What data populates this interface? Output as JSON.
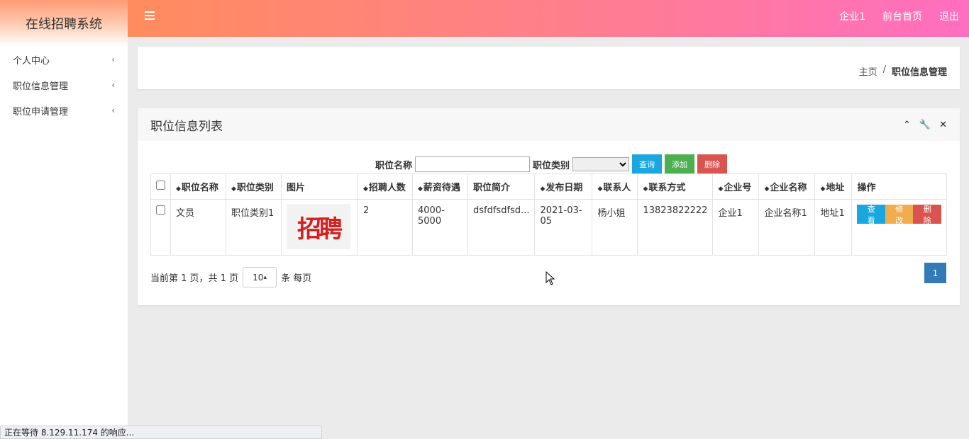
{
  "sidebar": {
    "title": "在线招聘系统",
    "items": [
      {
        "label": "个人中心",
        "chevron": "‹"
      },
      {
        "label": "职位信息管理",
        "chevron": "‹"
      },
      {
        "label": "职位申请管理",
        "chevron": "‹"
      }
    ]
  },
  "topbar": {
    "links": [
      "企业1",
      "前台首页",
      "退出"
    ]
  },
  "breadcrumb": {
    "home": "主页",
    "separator": "/",
    "current": "职位信息管理"
  },
  "panel": {
    "title": "职位信息列表",
    "tools": [
      "⌃",
      "🔧",
      "✕"
    ]
  },
  "search": {
    "name_label": "职位名称",
    "name_value": "",
    "type_label": "职位类别",
    "type_value": "",
    "query_btn": "查询",
    "add_btn": "添加",
    "delete_btn": "删除"
  },
  "table": {
    "headers": [
      "职位名称",
      "职位类别",
      "图片",
      "招聘人数",
      "薪资待遇",
      "职位简介",
      "发布日期",
      "联系人",
      "联系方式",
      "企业号",
      "企业名称",
      "地址",
      "操作"
    ],
    "rows": [
      {
        "name": "文员",
        "category": "职位类别1",
        "image_text": "招聘",
        "count": "2",
        "salary": "4000-5000",
        "intro": "dsfdfsdfsd...",
        "date": "2021-03-05",
        "contact": "杨小姐",
        "phone": "13823822222",
        "company_no": "企业1",
        "company_name": "企业名称1",
        "address": "地址1",
        "view_btn": "查看",
        "edit_btn": "修改",
        "delete_btn": "删除"
      }
    ]
  },
  "pager": {
    "info_prefix": "当前第 1 页，共 1 页",
    "page_size": "10",
    "page_size_arrow": "▴",
    "info_suffix": "条 每页",
    "current_page": "1"
  },
  "status_bar": "正在等待 8.129.11.174 的响应...",
  "colors": {
    "topbar_gradient": [
      "#ff8c5e",
      "#ff6ec0"
    ],
    "btn_query": "#1aa7e0",
    "btn_add": "#4caf50",
    "btn_delete": "#d9534f",
    "btn_edit": "#f0ad4e",
    "pager_active": "#337ab7"
  }
}
